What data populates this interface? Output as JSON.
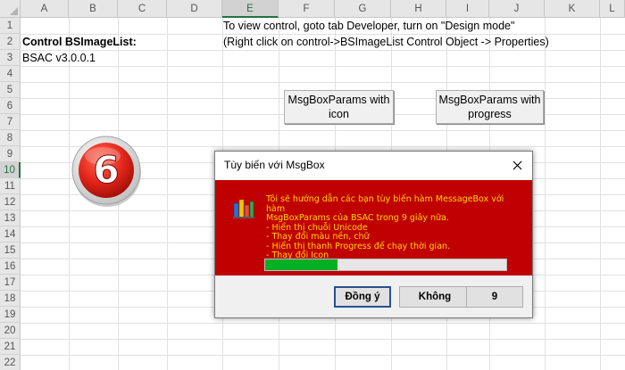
{
  "sheet": {
    "columns": [
      "A",
      "B",
      "C",
      "D",
      "E",
      "F",
      "G",
      "H",
      "I",
      "J",
      "K",
      "L"
    ],
    "rows": [
      "1",
      "2",
      "3",
      "4",
      "5",
      "6",
      "7",
      "8",
      "9",
      "10",
      "11",
      "12",
      "13",
      "14",
      "15",
      "16",
      "17",
      "18",
      "19",
      "20",
      "21",
      "22"
    ],
    "selected_column": "E",
    "selected_row": "10",
    "cells": {
      "e1": "To view control, goto tab Developer, turn on \"Design mode\"",
      "e2": "(Right click on control->BSImageList Control Object -> Properties)",
      "a2": "Control BSImageList:",
      "a3": "BSAC v3.0.0.1"
    },
    "buttons": {
      "msgbox_icon": "MsgBoxParams with icon",
      "msgbox_progress": "MsgBoxParams with progress"
    },
    "badge_number": "6"
  },
  "dialog": {
    "title": "Tùy biến với MsgBox",
    "message_lines": [
      "Tôi sẽ hướng dẫn các bạn tùy biến hàm MessageBox với hàm",
      "MsgBoxParams của BSAC trong 9 giây nữa.",
      "- Hiển thị chuỗi Unicode",
      "- Thay đổi màu nền, chữ",
      "- Hiển thị thanh Progress để chạy thời gian.",
      "- Thay đổi Icon"
    ],
    "progress": 0.3,
    "buttons": {
      "ok": "Đồng ý",
      "no": "Không",
      "countdown": "9"
    },
    "colors": {
      "background": "#c00000",
      "text": "#ffd400",
      "progress_fill": "#06b025"
    },
    "icons": {
      "message": "books-chart-icon",
      "close": "close-icon"
    }
  }
}
